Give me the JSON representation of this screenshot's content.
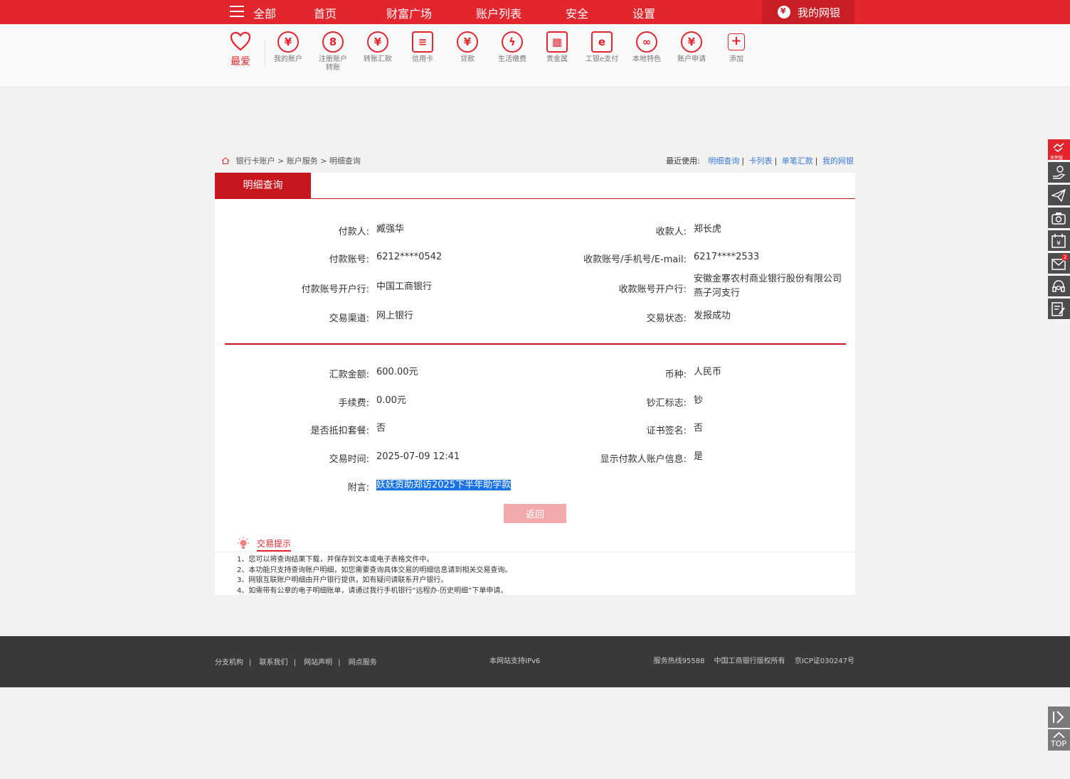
{
  "topnav": {
    "menu_label": "全部",
    "items": [
      "首页",
      "财富广场",
      "账户列表",
      "安全",
      "设置"
    ],
    "mybank": "我的网银"
  },
  "quickbar": {
    "favorite": "最爱",
    "items": [
      {
        "label": "我的账户",
        "icon": "yen-icon"
      },
      {
        "label": "注册账户转账",
        "icon": "user-transfer-icon"
      },
      {
        "label": "转账汇款",
        "icon": "transfer-icon"
      },
      {
        "label": "信用卡",
        "icon": "card-icon"
      },
      {
        "label": "贷款",
        "icon": "money-bag-icon"
      },
      {
        "label": "生活缴费",
        "icon": "drop-icon"
      },
      {
        "label": "贵金属",
        "icon": "gold-bar-icon"
      },
      {
        "label": "工银e支付",
        "icon": "epay-icon"
      },
      {
        "label": "本地特色",
        "icon": "local-icon"
      },
      {
        "label": "账户申请",
        "icon": "apply-icon"
      },
      {
        "label": "添加",
        "icon": "plus-icon"
      }
    ]
  },
  "breadcrumb": {
    "path": "银行卡账户 > 账户服务 > 明细查询"
  },
  "recent": {
    "label": "最近使用:",
    "links": [
      "明细查询",
      "卡列表",
      "单笔汇款",
      "我的网银"
    ]
  },
  "tab": {
    "active": "明细查询"
  },
  "detail": {
    "payer_label": "付款人:",
    "payer": "臧强华",
    "payee_label": "收款人:",
    "payee": "郑长虎",
    "payer_acct_label": "付款账号:",
    "payer_acct": "6212****0542",
    "payee_acct_label": "收款账号/手机号/E-mail:",
    "payee_acct": "6217****2533",
    "payer_bank_label": "付款账号开户行:",
    "payer_bank": "中国工商银行",
    "payee_bank_label": "收款账号开户行:",
    "payee_bank_1": "安徽金寨农村商业银行股份有限公司",
    "payee_bank_2": "燕子河支行",
    "channel_label": "交易渠道:",
    "channel": "网上银行",
    "status_label": "交易状态:",
    "status": "发报成功",
    "amount_label": "汇款金额:",
    "amount": "600.00元",
    "currency_label": "币种:",
    "currency": "人民币",
    "fee_label": "手续费:",
    "fee": "0.00元",
    "cash_label": "钞汇标志:",
    "cash": "钞",
    "package_label": "是否抵扣套餐:",
    "package": "否",
    "cert_label": "证书签名:",
    "cert": "否",
    "time_label": "交易时间:",
    "time": "2025-07-09 12:41",
    "show_payer_label": "显示付款人账户信息:",
    "show_payer": "是",
    "note_label": "附言:",
    "note": "妖妖资助郑访2025下半年助学款",
    "back_button": "返回"
  },
  "tips": {
    "title": "交易提示",
    "items": [
      "1、您可以将查询结果下载，并保存到文本或电子表格文件中。",
      "2、本功能只支持查询账户明细，如您需要查询具体交易的明细信息请到相关交易查询。",
      "3、网银互联账户明细由开户银行提供，如有疑问请联系开户银行。",
      "4、如需带有公章的电子明细账单，请通过我行手机银行“远程办-历史明细”下单申请。"
    ]
  },
  "footer": {
    "links": [
      "分支机构",
      "联系我们",
      "网站声明",
      "网点服务"
    ],
    "ipv6": "本网站支持IPv6",
    "hotline": "服务热线95588",
    "copyright": "中国工商银行版权所有",
    "icp": "京ICP证030247号"
  },
  "side": {
    "care_label": "关怀版",
    "mail_badge": "2",
    "top_label": "TOP"
  }
}
